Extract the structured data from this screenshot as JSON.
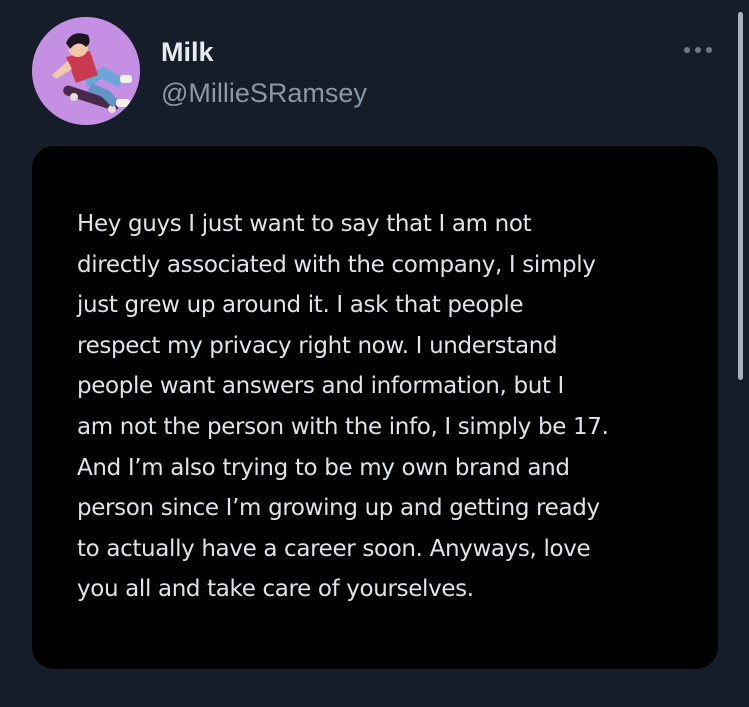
{
  "tweet": {
    "display_name": "Milk",
    "handle": "@MillieSRamsey",
    "avatar_icon": "profile-avatar",
    "more_icon": "more-horizontal-icon",
    "note_text": "Hey guys I just want to say that I am not\ndirectly associated with the company, I simply\njust grew up around it. I ask that people\nrespect my privacy right now. I understand\npeople want answers and information, but I\nam not the person with the info, I simply be 17.\nAnd I’m also trying to be my own brand and\nperson since I’m growing up and getting ready\nto actually have a career soon. Anyways, love\nyou all and take care of yourselves."
  },
  "colors": {
    "background": "#151d28",
    "card": "#000000",
    "name": "#e8ebef",
    "handle": "#8b98a5",
    "avatar_bg": "#c08fe0"
  }
}
